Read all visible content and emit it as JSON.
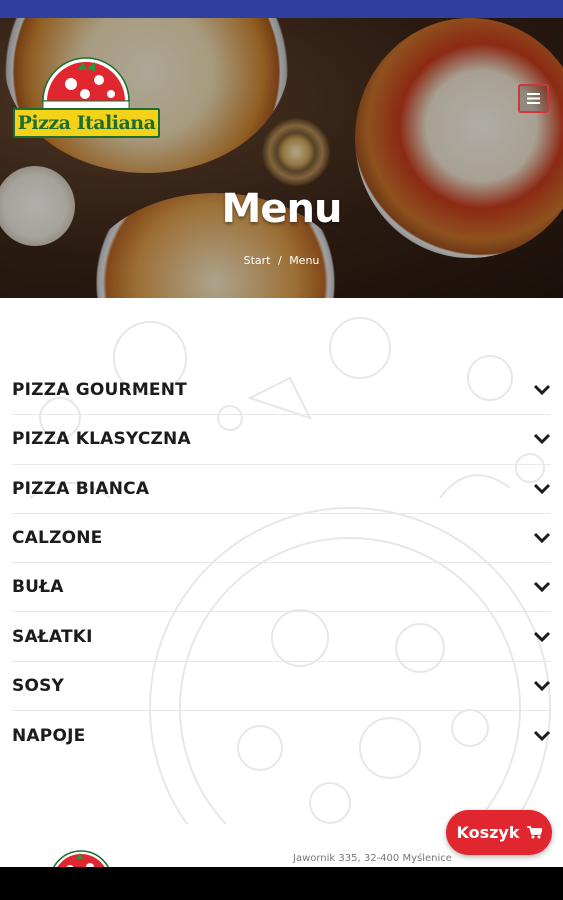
{
  "brand": {
    "logo_text": "Pizza Italiana",
    "primary_red": "#e0262f",
    "logo_green": "#1b6e2f",
    "logo_yellow": "#f4d21a",
    "status_bar": "#2f3e9f"
  },
  "header": {
    "menu_icon": "hamburger-icon",
    "title": "Menu",
    "breadcrumb": {
      "start": "Start",
      "separator": "/",
      "current": "Menu"
    }
  },
  "menu": {
    "items": [
      {
        "label": "PIZZA GOURMENT",
        "icon": "chevron-down-icon"
      },
      {
        "label": "PIZZA KLASYCZNA",
        "icon": "chevron-down-icon"
      },
      {
        "label": "PIZZA BIANCA",
        "icon": "chevron-down-icon"
      },
      {
        "label": "CALZONE",
        "icon": "chevron-down-icon"
      },
      {
        "label": "BUŁA",
        "icon": "chevron-down-icon"
      },
      {
        "label": "SAŁATKI",
        "icon": "chevron-down-icon"
      },
      {
        "label": "SOSY",
        "icon": "chevron-down-icon"
      },
      {
        "label": "NAPOJE",
        "icon": "chevron-down-icon"
      }
    ]
  },
  "cart": {
    "label": "Koszyk",
    "icon": "cart-icon"
  },
  "footer": {
    "address": "Jawornik 335, 32-400 Myślenice"
  }
}
